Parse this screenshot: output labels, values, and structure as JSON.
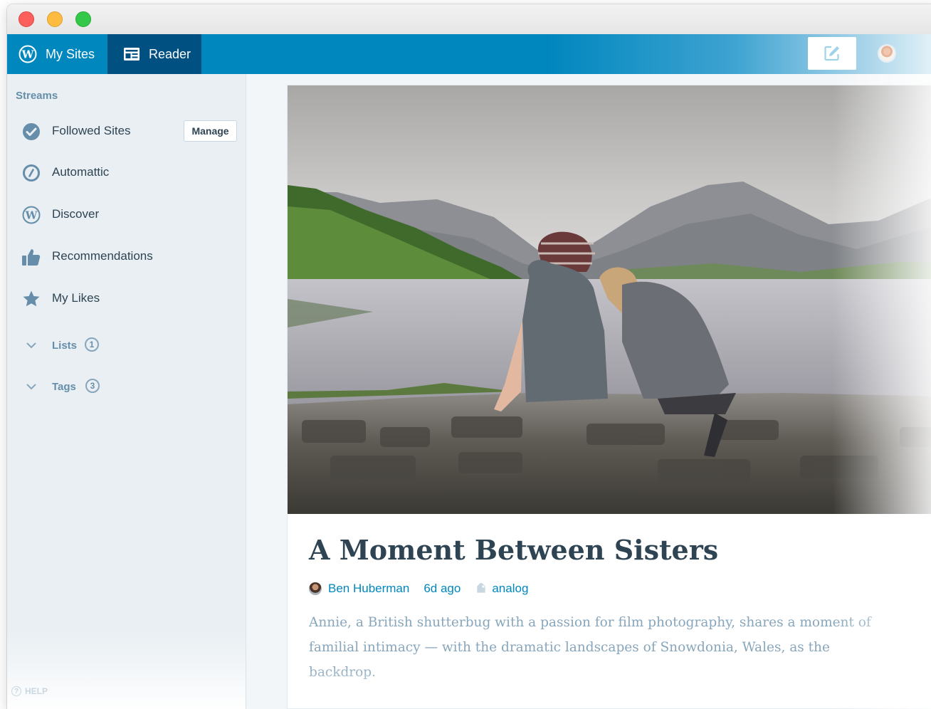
{
  "window": {
    "controls": [
      "close",
      "minimize",
      "maximize"
    ]
  },
  "masterbar": {
    "my_sites_label": "My Sites",
    "reader_label": "Reader",
    "icons": {
      "my_sites": "wordpress-logo-icon",
      "reader": "reader-icon",
      "write": "write-post-icon",
      "avatar": "user-avatar"
    },
    "colors": {
      "bar": "#0087be",
      "active": "#005082"
    }
  },
  "sidebar": {
    "heading": "Streams",
    "items": [
      {
        "label": "Followed Sites",
        "icon": "checkmark-circle-icon",
        "action_label": "Manage"
      },
      {
        "label": "Automattic",
        "icon": "automattic-logo-icon"
      },
      {
        "label": "Discover",
        "icon": "wordpress-logo-icon"
      },
      {
        "label": "Recommendations",
        "icon": "thumbs-up-icon"
      },
      {
        "label": "My Likes",
        "icon": "star-icon"
      }
    ],
    "groups": [
      {
        "label": "Lists",
        "count": "1",
        "icon": "chevron-down-icon"
      },
      {
        "label": "Tags",
        "count": "3",
        "icon": "chevron-down-icon"
      }
    ],
    "help_label": "HELP"
  },
  "post": {
    "title": "A Moment Between Sisters",
    "author": "Ben Huberman",
    "time_ago": "6d ago",
    "tag": "analog",
    "excerpt": "Annie, a British shutterbug with a passion for film photography, shares a moment of familial intimacy — with the dramatic landscapes of Snowdonia, Wales, as the backdrop.",
    "featured_image": "photo of two sisters sitting on a stone wall overlooking a lake and mountains",
    "colors": {
      "title": "#2e4453",
      "link": "#0087be",
      "excerpt": "#87a6bc"
    }
  }
}
